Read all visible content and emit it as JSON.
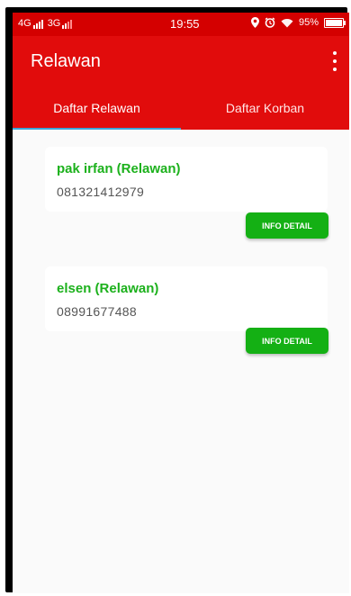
{
  "status": {
    "net1": "4G",
    "net2": "3G",
    "time": "19:55",
    "battery": "95%"
  },
  "appbar": {
    "title": "Relawan"
  },
  "tabs": [
    {
      "label": "Daftar Relawan",
      "selected": true
    },
    {
      "label": "Daftar Korban",
      "selected": false
    }
  ],
  "volunteers": [
    {
      "name": "pak irfan (Relawan)",
      "phone": "081321412979",
      "button": "INFO DETAIL"
    },
    {
      "name": "elsen (Relawan)",
      "phone": "08991677488",
      "button": "INFO DETAIL"
    }
  ],
  "colors": {
    "appbar": "#e10c0c",
    "statusbar": "#d40000",
    "accent_green": "#14b014",
    "tab_indicator": "#3ea6d8"
  }
}
